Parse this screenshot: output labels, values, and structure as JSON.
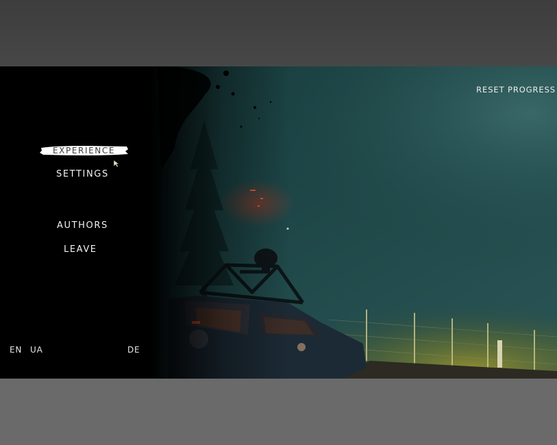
{
  "menu": {
    "items": [
      {
        "label": "EXPERIENCE"
      },
      {
        "label": "SETTINGS"
      },
      {
        "label": "AUTHORS"
      },
      {
        "label": "LEAVE"
      }
    ]
  },
  "top_right": {
    "reset_label": "RESET PROGRESS"
  },
  "languages": {
    "items": [
      {
        "code": "EN"
      },
      {
        "code": "UA"
      },
      {
        "code": "DE"
      }
    ]
  },
  "colors": {
    "menu_text": "#f2f2f2",
    "highlight_brush": "#ffffff",
    "scene_teal": "#1f4a4c",
    "fog_yellow": "#8c8a2f"
  }
}
